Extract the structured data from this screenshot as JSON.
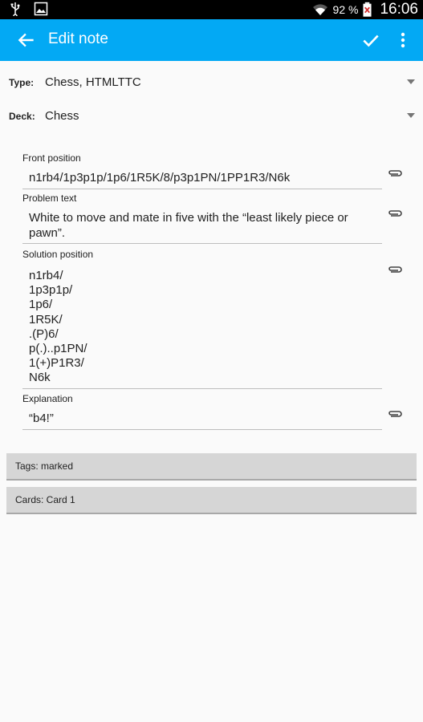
{
  "status_bar": {
    "battery_percent": "92 %",
    "time": "16:06",
    "icons": [
      "usb-icon",
      "image-icon",
      "wifi-icon",
      "battery-icon"
    ]
  },
  "app_bar": {
    "title": "Edit note",
    "icons": [
      "back-arrow-icon",
      "check-icon",
      "more-vert-icon"
    ],
    "color": "#03a9f4"
  },
  "selectors": {
    "type": {
      "label": "Type:",
      "value": "Chess, HTMLTTC"
    },
    "deck": {
      "label": "Deck:",
      "value": "Chess"
    }
  },
  "fields": [
    {
      "label": "Front position",
      "value": "n1rb4/1p3p1p/1p6/1R5K/8/p3p1PN/1PP1R3/N6k"
    },
    {
      "label": "Problem text",
      "value_lines": [
        "White to move and mate in five with the “least likely piece or",
        "pawn”."
      ]
    },
    {
      "label": "Solution position",
      "value_lines": [
        "n1rb4/",
        "1p3p1p/",
        "1p6/",
        "1R5K/",
        ".(P)6/",
        "p(.)..p1PN/",
        "1(+)P1R3/",
        "N6k"
      ]
    },
    {
      "label": "Explanation",
      "value": "“b4!”"
    }
  ],
  "tags_bar": {
    "label": "Tags: marked"
  },
  "cards_bar": {
    "label": "Cards: Card 1"
  }
}
